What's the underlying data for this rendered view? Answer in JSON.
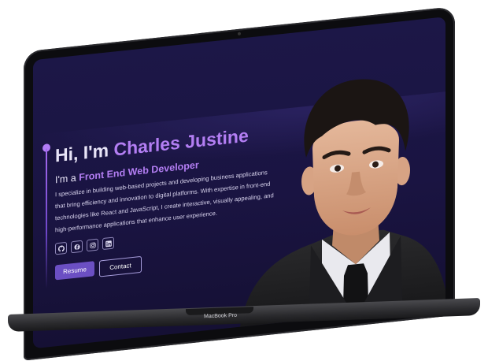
{
  "hero": {
    "greeting": "Hi, I'm",
    "name": "Charles Justine",
    "role_prefix": "I'm a",
    "role": "Front End Web Developer",
    "bio": "I specialize in building web-based projects and developing business applications that bring efficiency and innovation to digital platforms. With expertise in front-end technologies like React and JavaScript, I create interactive, visually appealing, and high-performance applications that enhance user experience."
  },
  "socials": [
    {
      "icon": "github-icon"
    },
    {
      "icon": "facebook-icon"
    },
    {
      "icon": "instagram-icon"
    },
    {
      "icon": "linkedin-icon"
    }
  ],
  "buttons": {
    "resume": "Resume",
    "contact": "Contact"
  },
  "laptop": {
    "brand": "MacBook Pro"
  },
  "colors": {
    "accent": "#b37ef3",
    "background": "#1c1747",
    "button": "#6b4fc3"
  }
}
